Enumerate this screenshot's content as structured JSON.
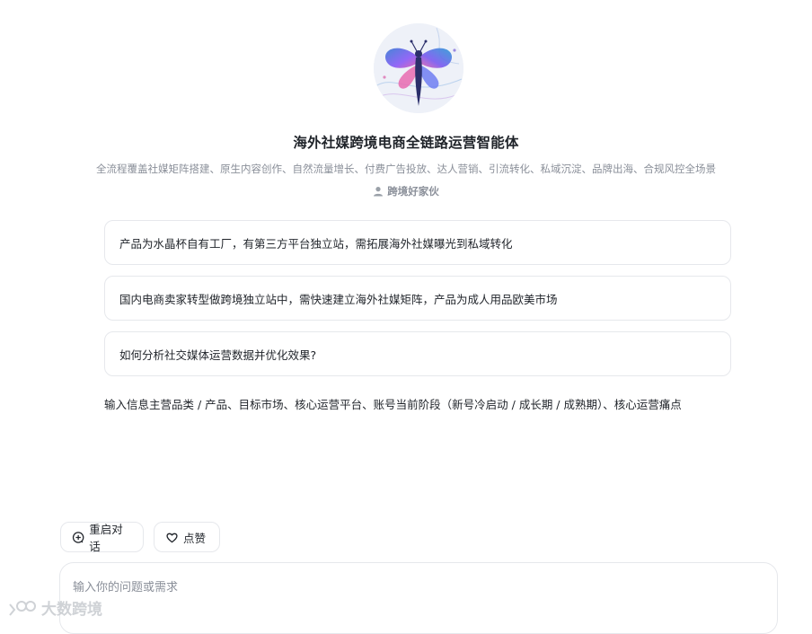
{
  "agent": {
    "title": "海外社媒跨境电商全链路运营智能体",
    "subtitle": "全流程覆盖社媒矩阵搭建、原生内容创作、自然流量增长、付费广告投放、达人营销、引流转化、私域沉淀、品牌出海、合规风控全场景",
    "author": "跨境好家伙",
    "avatar_icon": "dragonfly-icon"
  },
  "suggestions": [
    {
      "text": "产品为水晶杯自有工厂，有第三方平台独立站，需拓展海外社媒曝光到私域转化"
    },
    {
      "text": "国内电商卖家转型做跨境独立站中，需快速建立海外社媒矩阵，产品为成人用品欧美市场"
    },
    {
      "text": "如何分析社交媒体运营数据并优化效果?"
    }
  ],
  "hint": "输入信息主营品类 / 产品、目标市场、核心运营平台、账号当前阶段（新号冷启动 / 成长期 / 成熟期）、核心运营痛点",
  "actions": {
    "restart_label": "重启对话",
    "restart_icon": "plus-circle-icon",
    "like_label": "点赞",
    "like_icon": "heart-icon"
  },
  "input": {
    "placeholder": "输入你的问题或需求"
  },
  "watermark": {
    "text": "大数跨境"
  }
}
